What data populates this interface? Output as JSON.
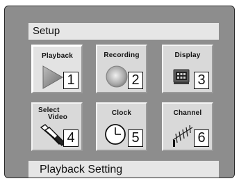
{
  "header": {
    "title": "Setup"
  },
  "footer": {
    "status": "Playback Setting"
  },
  "menu": {
    "items": [
      {
        "label": "Playback",
        "number": "1",
        "icon": "play-triangle-icon",
        "selected": true
      },
      {
        "label": "Recording",
        "number": "2",
        "icon": "record-circle-icon"
      },
      {
        "label": "Display",
        "number": "3",
        "icon": "display-panel-icon"
      },
      {
        "label_line1": "Select",
        "label_line2": "Video",
        "number": "4",
        "icon": "video-cable-icon"
      },
      {
        "label": "Clock",
        "number": "5",
        "icon": "clock-icon"
      },
      {
        "label": "Channel",
        "number": "6",
        "icon": "antenna-icon"
      }
    ]
  },
  "colors": {
    "panel_background": "#8d8d8d",
    "bar_background": "#e6e6e6",
    "tile_background": "#d9d9d9"
  }
}
